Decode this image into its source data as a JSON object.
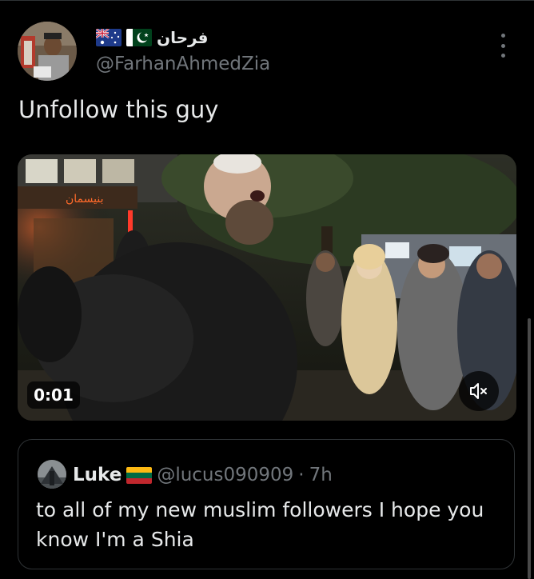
{
  "tweet": {
    "display_name": "فرحان",
    "handle": "@FarhanAhmedZia",
    "text": "Unfollow this guy",
    "flags": [
      "australia-flag",
      "pakistan-flag"
    ]
  },
  "video": {
    "timestamp": "0:01",
    "shop_sign_text": "بنيسمان",
    "muted": true
  },
  "quoted_tweet": {
    "name": "Luke",
    "flag": "lithuania-flag",
    "handle": "@lucus090909",
    "separator": "·",
    "time": "7h",
    "body": "to all of my new muslim followers I hope you know I'm a Shia"
  },
  "colors": {
    "background": "#000000",
    "primary_text": "#e7e9ea",
    "secondary_text": "#71767b",
    "border": "#2f3336"
  },
  "icons": {
    "more": "more-vertical-icon",
    "mute": "volume-muted-icon"
  }
}
